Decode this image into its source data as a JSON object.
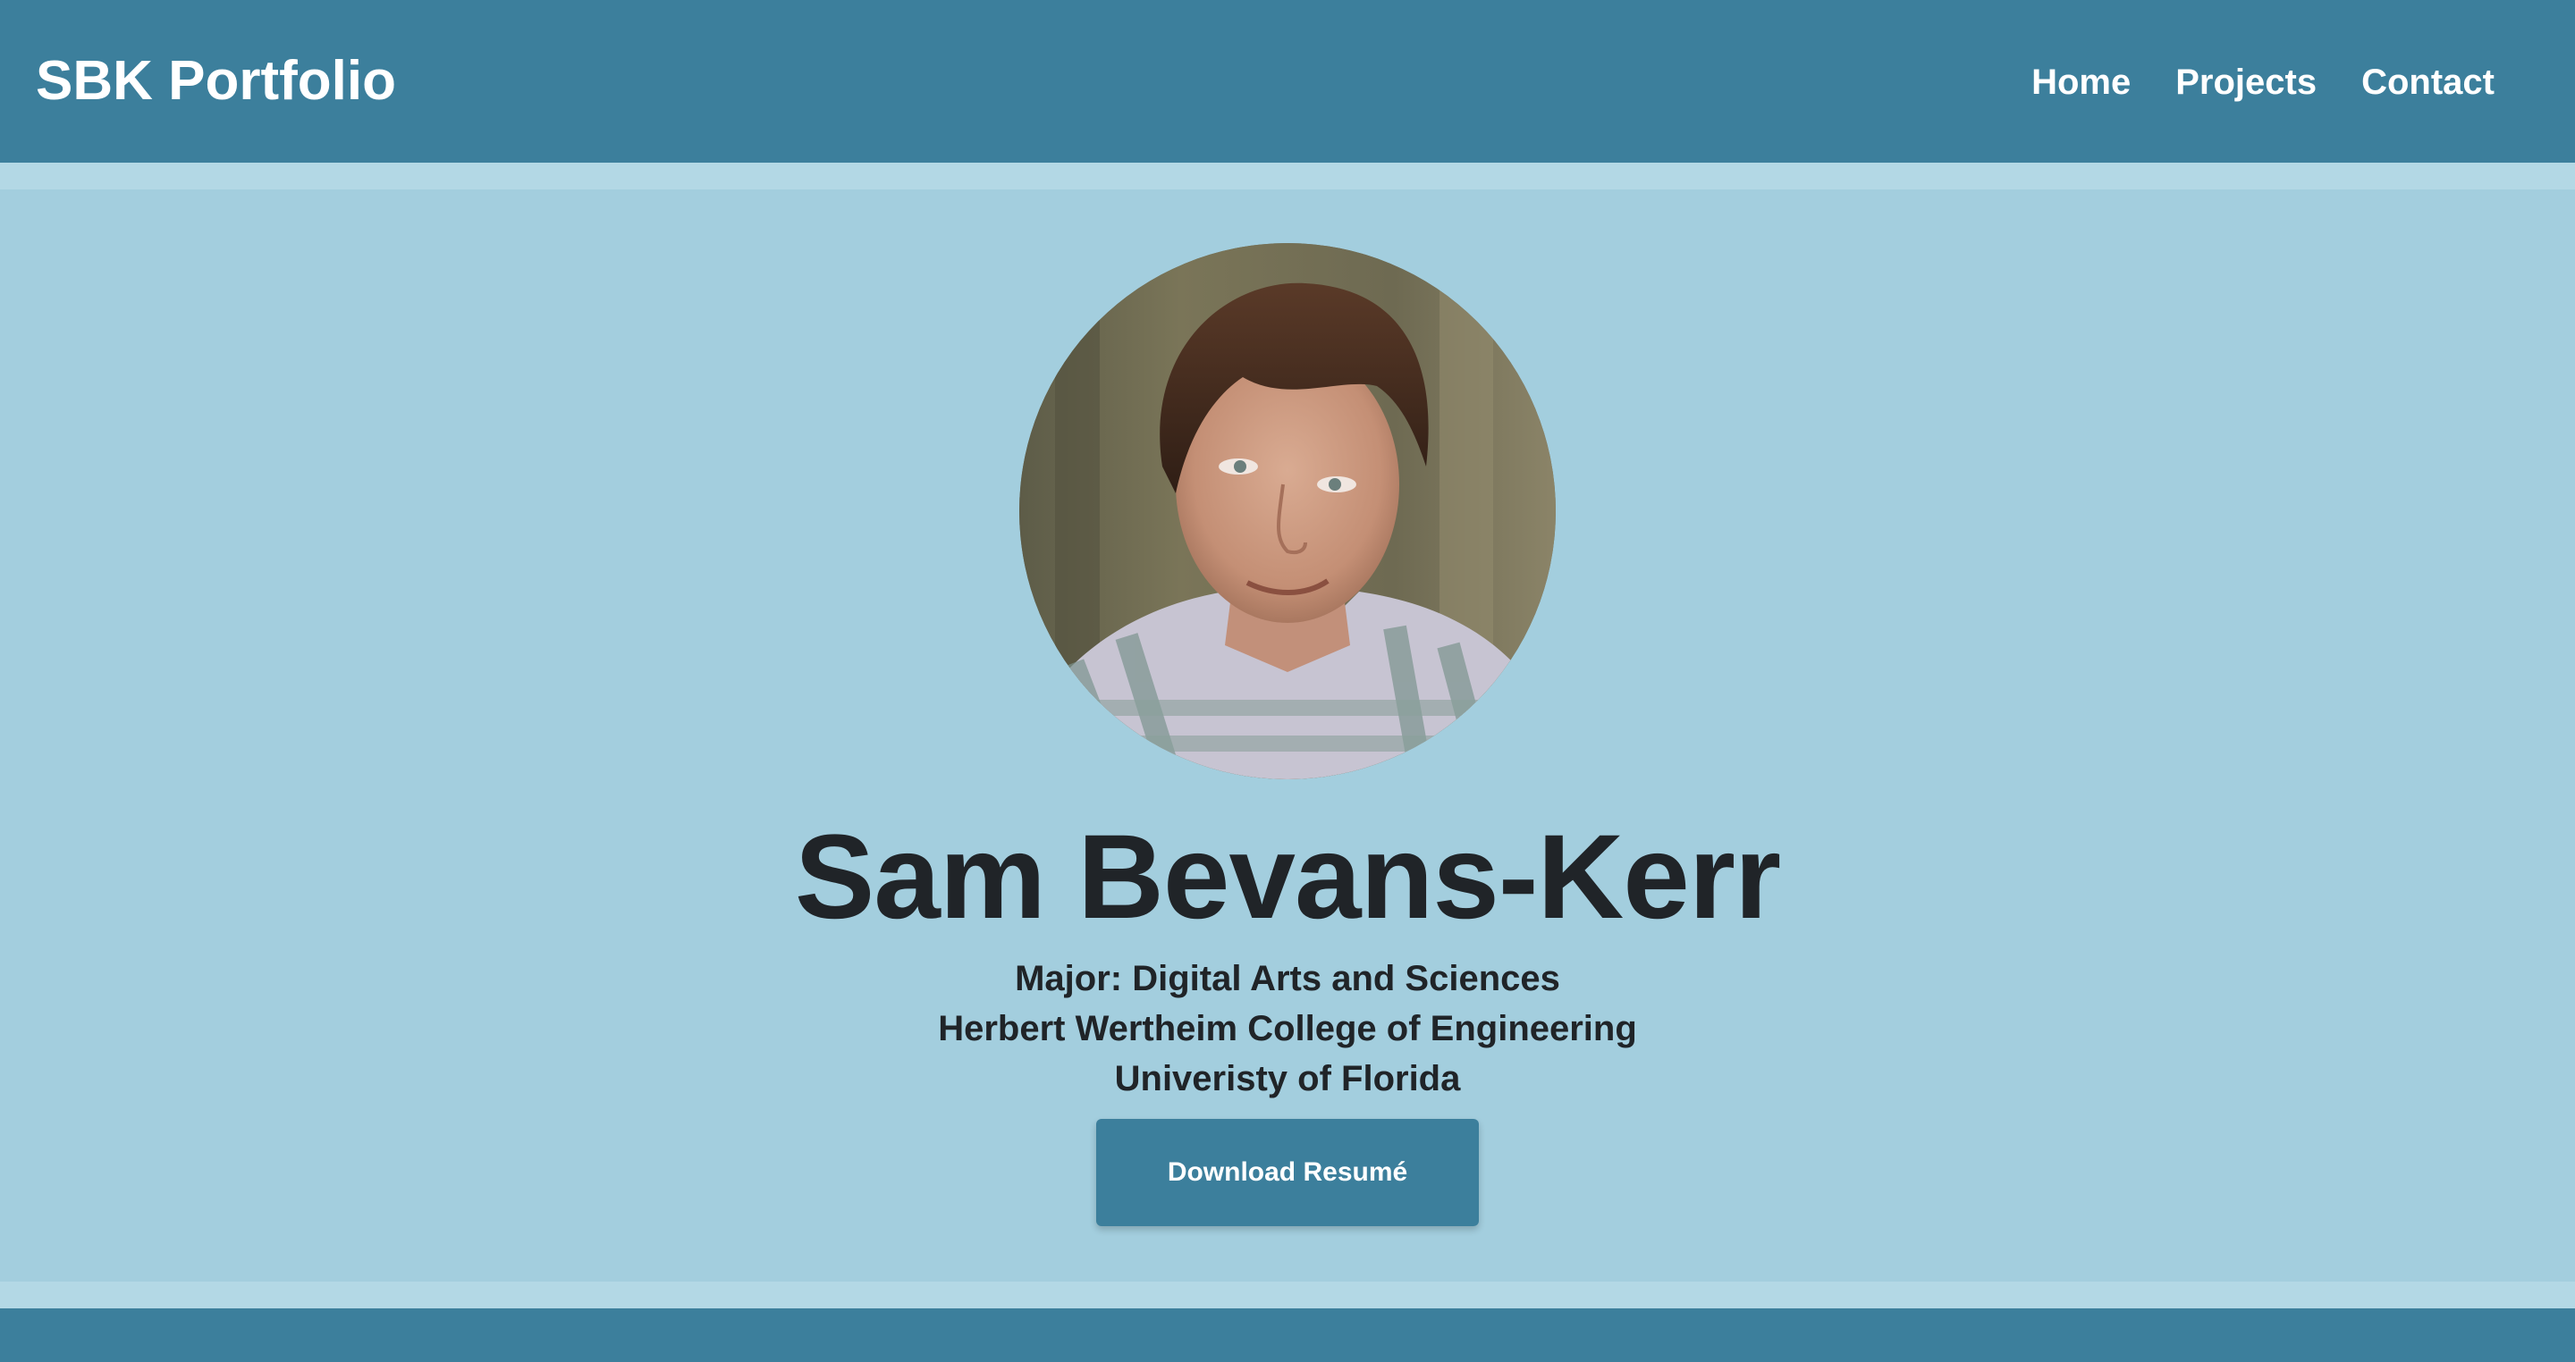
{
  "navbar": {
    "brand": "SBK Portfolio",
    "links": [
      {
        "label": "Home"
      },
      {
        "label": "Projects"
      },
      {
        "label": "Contact"
      }
    ]
  },
  "hero": {
    "name": "Sam Bevans-Kerr",
    "lines": [
      "Major: Digital Arts and Sciences",
      "Herbert Wertheim College of Engineering",
      "Univeristy of Florida"
    ],
    "button_label": "Download Resumé"
  },
  "colors": {
    "navbar": "#3c7f9c",
    "hero_background": "#a3cede",
    "strip": "#b3d8e5",
    "text": "#202428",
    "button": "#3c7f9c"
  }
}
